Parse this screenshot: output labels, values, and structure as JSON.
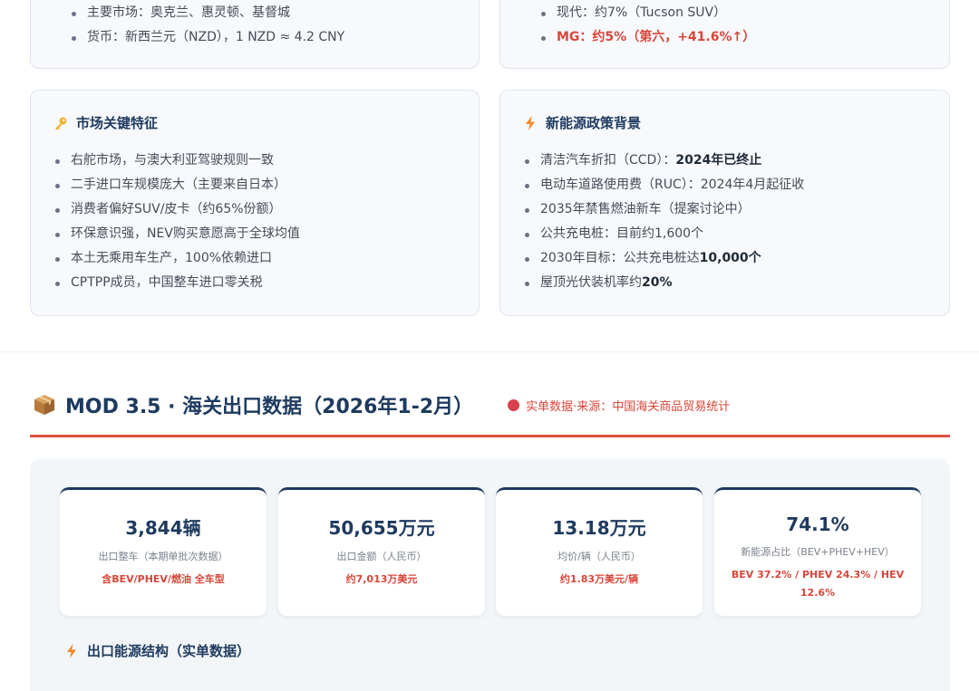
{
  "card_a": {
    "items": [
      "主要市场：奥克兰、惠灵顿、基督城",
      "货币：新西兰元（NZD），1 NZD ≈ 4.2 CNY"
    ]
  },
  "card_b": {
    "items": [
      "现代：约7%（Tucson SUV）",
      "MG：约5%（第六，+41.6%↑）"
    ]
  },
  "market_features": {
    "title": "市场关键特征",
    "icon": "key-icon",
    "items": [
      "右舵市场，与澳大利亚驾驶规则一致",
      "二手进口车规模庞大（主要来自日本）",
      "消费者偏好SUV/皮卡（约65%份额）",
      "环保意识强，NEV购买意愿高于全球均值",
      "本土无乘用车生产，100%依赖进口",
      "CPTPP成员，中国整车进口零关税"
    ]
  },
  "nev_policy": {
    "title": "新能源政策背景",
    "icon": "lightning-icon",
    "items": [
      {
        "pre": "清洁汽车折扣（CCD）：",
        "bold": "2024年已终止"
      },
      {
        "pre": "电动车道路使用费（RUC）：2024年4月起征收",
        "bold": ""
      },
      {
        "pre": "2035年禁售燃油新车（提案讨论中）",
        "bold": ""
      },
      {
        "pre": "公共充电桩：目前约1,600个",
        "bold": ""
      },
      {
        "pre": "2030年目标：公共充电桩达",
        "bold": "10,000个"
      },
      {
        "pre": "屋顶光伏装机率约",
        "bold": "20%"
      }
    ]
  },
  "section": {
    "icon": "package-icon",
    "title": "MOD 3.5 · 海关出口数据（2026年1-2月）",
    "note": "实单数据·来源：中国海关商品贸易统计"
  },
  "stats": [
    {
      "value": "3,844辆",
      "label": "出口整车（本期单批次数据）",
      "sub": "含BEV/PHEV/燃油 全车型"
    },
    {
      "value": "50,655万元",
      "label": "出口金额（人民币）",
      "sub": "约7,013万美元"
    },
    {
      "value": "13.18万元",
      "label": "均价/辆（人民币）",
      "sub": "约1.83万美元/辆"
    },
    {
      "value": "74.1%",
      "label": "新能源占比（BEV+PHEV+HEV）",
      "sub": "BEV 37.2% / PHEV 24.3% / HEV 12.6%"
    }
  ],
  "energy_structure": {
    "icon": "lightning-icon",
    "title": "出口能源结构（实单数据）"
  },
  "colors": {
    "navy": "#1e3a5f",
    "accent_red": "#d9463a",
    "panel_bg": "#f3f6f9"
  }
}
